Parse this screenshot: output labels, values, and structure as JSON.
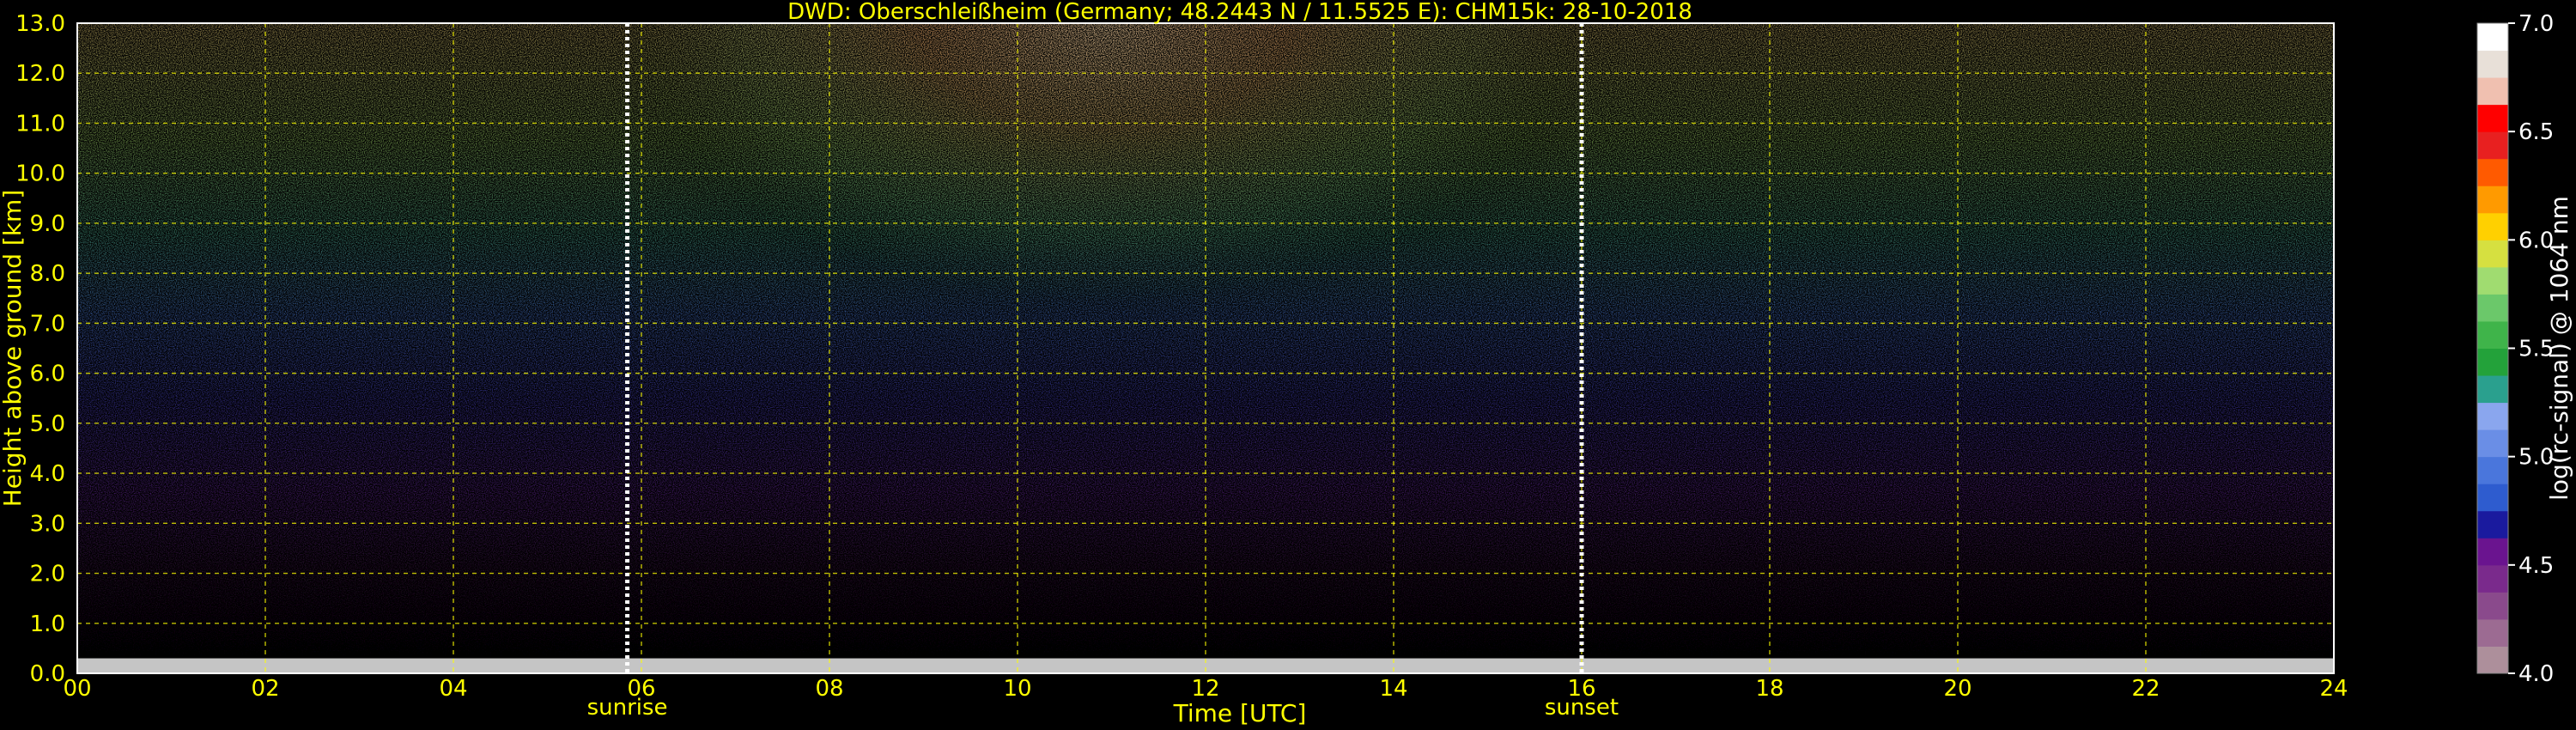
{
  "chart_data": {
    "type": "heatmap",
    "title": "DWD: Oberschleißheim (Germany; 48.2443 N / 11.5525 E):    CHM15k: 28-10-2018",
    "xlabel": "Time [UTC]",
    "ylabel": "Height above ground [km]",
    "xlim": [
      0,
      24
    ],
    "ylim": [
      0,
      13
    ],
    "x_ticks": [
      "00",
      "02",
      "04",
      "06",
      "08",
      "10",
      "12",
      "14",
      "16",
      "18",
      "20",
      "22",
      "24"
    ],
    "y_ticks": [
      "0.0",
      "1.0",
      "2.0",
      "3.0",
      "4.0",
      "5.0",
      "6.0",
      "7.0",
      "8.0",
      "9.0",
      "10.0",
      "11.0",
      "12.0",
      "13.0"
    ],
    "grid": true,
    "markers": [
      {
        "label": "sunrise",
        "x": 5.85
      },
      {
        "label": "sunset",
        "x": 16.0
      }
    ],
    "colorbar": {
      "label": "log(rc-signal) @ 1064 nm",
      "range": [
        4.0,
        7.0
      ],
      "ticks": [
        "4.0",
        "4.5",
        "5.0",
        "5.5",
        "6.0",
        "6.5",
        "7.0"
      ],
      "colors": [
        "#ad8f9b",
        "#9c6b92",
        "#8a4a8c",
        "#7a2a8c",
        "#6a148f",
        "#1a1a9e",
        "#2e5ccf",
        "#4a76dc",
        "#6a8ee6",
        "#8aa6ee",
        "#2aa08e",
        "#23a23a",
        "#3fb44a",
        "#6bc86a",
        "#a0dc70",
        "#d6e040",
        "#ffd000",
        "#ff9a00",
        "#ff5a00",
        "#e82020",
        "#ff0000",
        "#f0c0b0",
        "#e8e0d8",
        "#ffffff"
      ]
    },
    "colors": {
      "text": "#ffff00",
      "grid": "#ffff00",
      "background": "#000000",
      "axis_frame": "#ffffff"
    }
  }
}
